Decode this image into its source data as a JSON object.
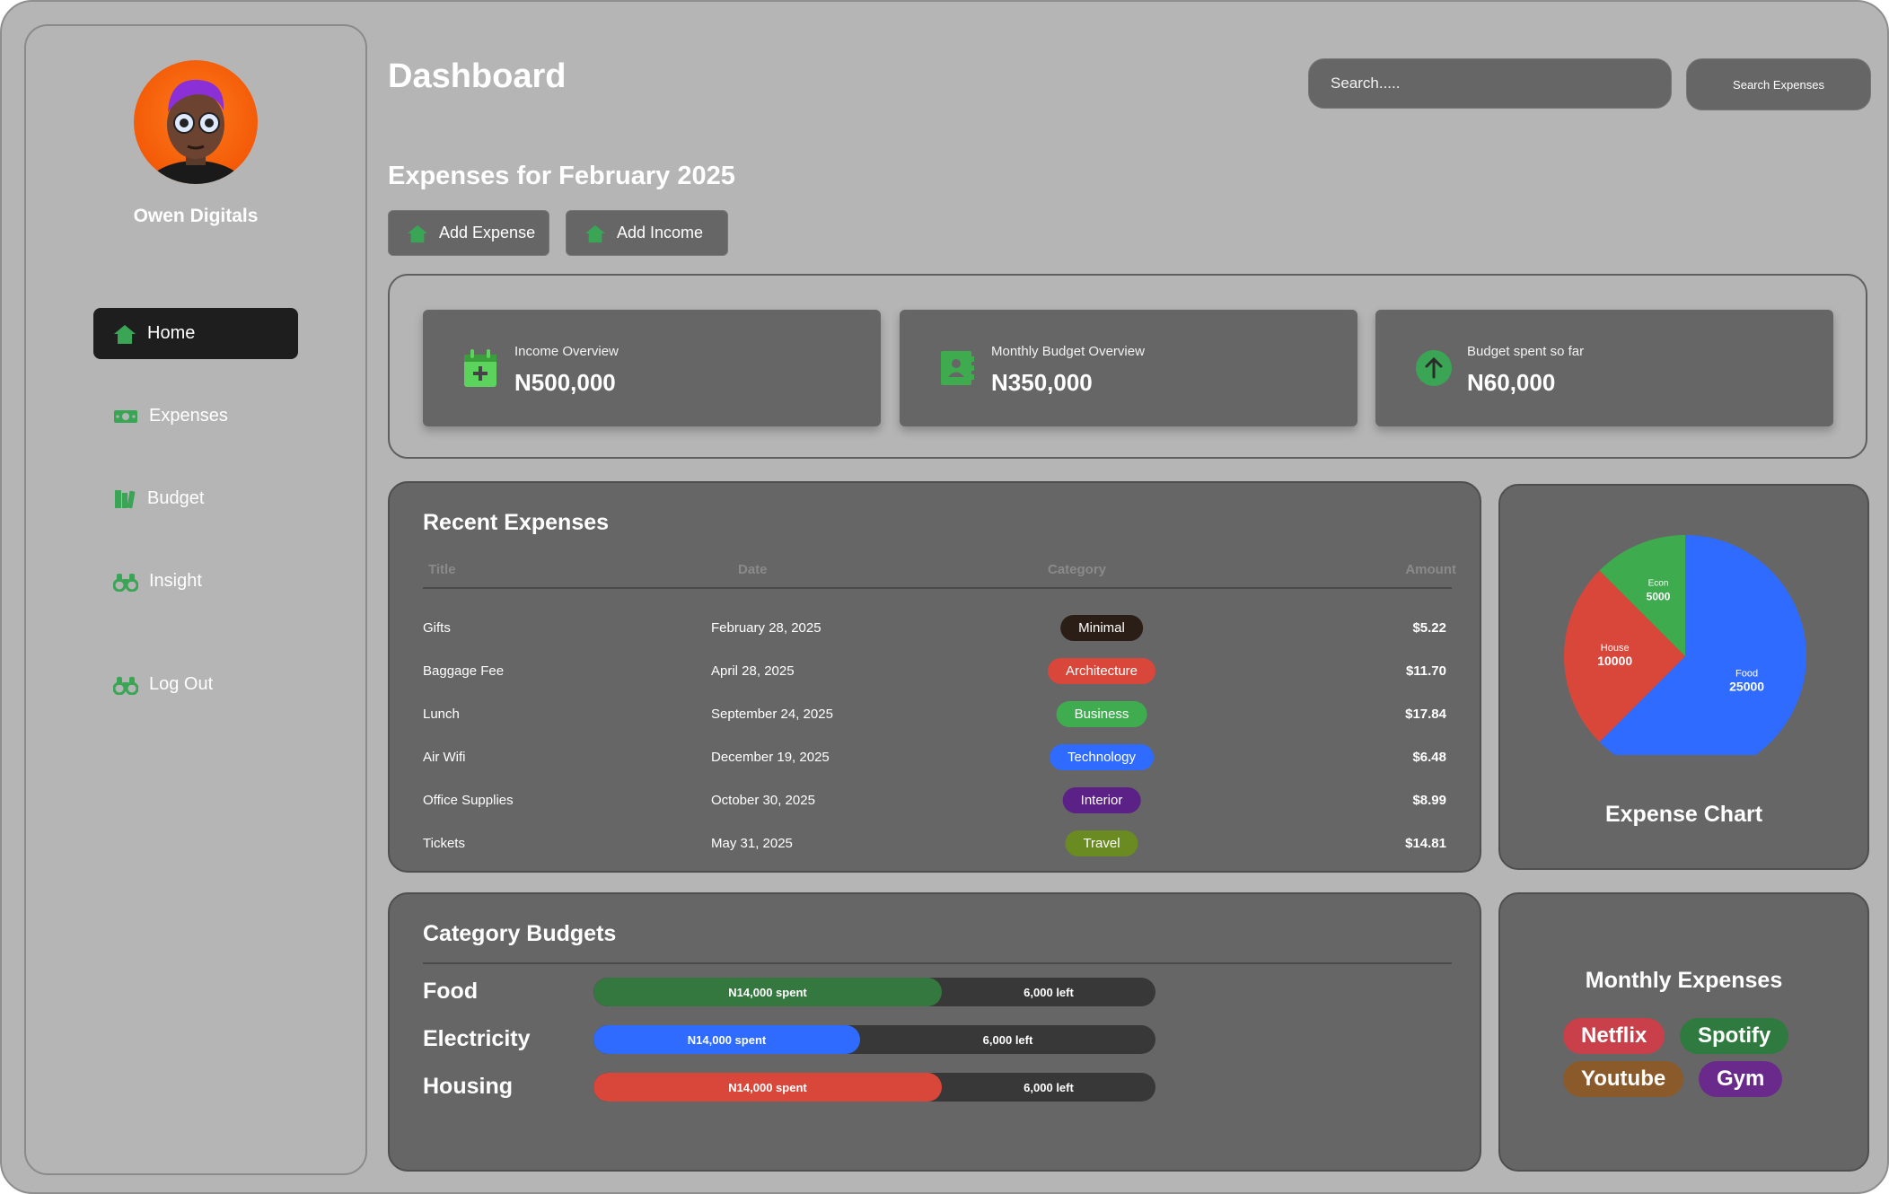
{
  "colors": {
    "accent_green": "#3aa655",
    "food": "#2f6bff",
    "house": "#d9473b",
    "econ": "#3eab4f"
  },
  "profile": {
    "name": "Owen Digitals",
    "avatar_icon": "avatar-illustration"
  },
  "nav": {
    "home": "Home",
    "expenses": "Expenses",
    "budget": "Budget",
    "insight": "Insight",
    "logout": "Log Out"
  },
  "header": {
    "title": "Dashboard",
    "search_placeholder": "Search.....",
    "search_button": "Search Expenses"
  },
  "expenses_section": {
    "title": "Expenses for February 2025",
    "add_expense": "Add Expense",
    "add_income": "Add Income"
  },
  "stats": [
    {
      "label": "Income Overview",
      "value": "N500,000",
      "icon": "calendar-plus-icon"
    },
    {
      "label": "Monthly Budget Overview",
      "value": "N350,000",
      "icon": "contact-book-icon"
    },
    {
      "label": "Budget spent so far",
      "value": "N60,000",
      "icon": "arrow-up-circle-icon"
    }
  ],
  "recent_expenses": {
    "title": "Recent Expenses",
    "columns": [
      "Title",
      "Date",
      "Category",
      "Amount"
    ],
    "rows": [
      {
        "title": "Gifts",
        "date": "February 28, 2025",
        "category": "Minimal",
        "category_color": "#2b1e17",
        "amount": "$5.22"
      },
      {
        "title": "Baggage Fee",
        "date": "April 28, 2025",
        "category": "Architecture",
        "category_color": "#d9473b",
        "amount": "$11.70"
      },
      {
        "title": "Lunch",
        "date": "September 24, 2025",
        "category": "Business",
        "category_color": "#3fad4f",
        "amount": "$17.84"
      },
      {
        "title": "Air Wifi",
        "date": "December 19, 2025",
        "category": "Technology",
        "category_color": "#2f6bff",
        "amount": "$6.48"
      },
      {
        "title": "Office Supplies",
        "date": "October 30, 2025",
        "category": "Interior",
        "category_color": "#5b2186",
        "amount": "$8.99"
      },
      {
        "title": "Tickets",
        "date": "May 31, 2025",
        "category": "Travel",
        "category_color": "#6a8a22",
        "amount": "$14.81"
      }
    ]
  },
  "chart_data": {
    "type": "pie",
    "title": "Expense Chart",
    "slices": [
      {
        "label": "Food",
        "value": 25000,
        "color": "#2f6bff"
      },
      {
        "label": "House",
        "value": 10000,
        "color": "#d9473b"
      },
      {
        "label": "Econ",
        "value": 5000,
        "color": "#3eab4f"
      }
    ]
  },
  "category_budgets": {
    "title": "Category Budgets",
    "items": [
      {
        "name": "Food",
        "spent": "N14,000 spent",
        "left": "6,000 left",
        "spent_fraction": 0.62,
        "color": "#34773f"
      },
      {
        "name": "Electricity",
        "spent": "N14,000 spent",
        "left": "6,000 left",
        "spent_fraction": 0.475,
        "color": "#2f6bff"
      },
      {
        "name": "Housing",
        "spent": "N14,000 spent",
        "left": "6,000 left",
        "spent_fraction": 0.62,
        "color": "#d9473b"
      }
    ]
  },
  "monthly_expenses": {
    "title": "Monthly Expenses",
    "chips": [
      {
        "label": "Netflix",
        "color": "#c9404a"
      },
      {
        "label": "Spotify",
        "color": "#2f7a3e"
      },
      {
        "label": "Youtube",
        "color": "#8a5a2b"
      },
      {
        "label": "Gym",
        "color": "#6a2a8c"
      }
    ]
  }
}
